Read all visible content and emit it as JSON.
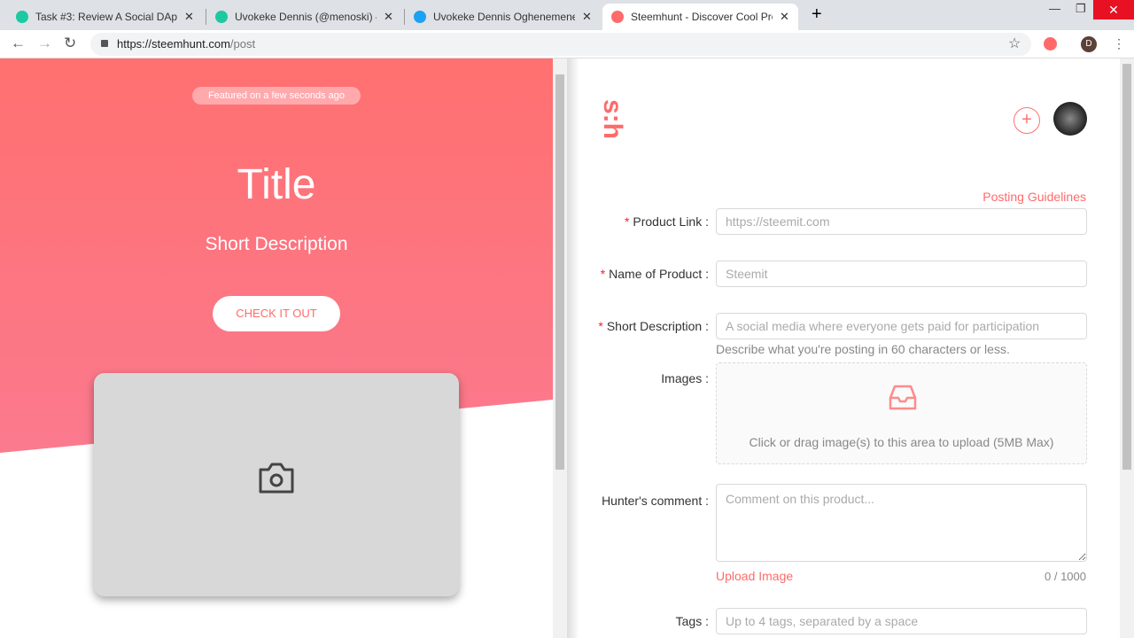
{
  "browser": {
    "tabs": [
      {
        "title": "Task #3: Review A Social DApp! -",
        "icon_color": "#1dc9a0"
      },
      {
        "title": "Uvokeke Dennis (@menoski) — S",
        "icon_color": "#1dc9a0"
      },
      {
        "title": "Uvokeke Dennis Oghenemene on",
        "icon_color": "#1da1f2"
      },
      {
        "title": "Steemhunt - Discover Cool Prod",
        "icon_color": "#ff6b6b"
      }
    ],
    "url_host": "https://steemhunt.com",
    "url_path": "/post",
    "profile_initial": "D"
  },
  "preview": {
    "badge": "Featured on a few seconds ago",
    "title": "Title",
    "short_description": "Short Description",
    "cta": "CHECK IT OUT"
  },
  "header": {
    "logo": "s:h"
  },
  "form": {
    "guidelines": "Posting Guidelines",
    "product_link": {
      "label": "Product Link",
      "placeholder": "https://steemit.com"
    },
    "name": {
      "label": "Name of Product",
      "placeholder": "Steemit"
    },
    "short_description": {
      "label": "Short Description",
      "placeholder": "A social media where everyone gets paid for participation",
      "help": "Describe what you're posting in 60 characters or less."
    },
    "images": {
      "label": "Images",
      "hint": "Click or drag image(s) to this area to upload (5MB Max)"
    },
    "comment": {
      "label": "Hunter's comment",
      "placeholder": "Comment on this product...",
      "upload": "Upload Image",
      "count": "0 / 1000"
    },
    "tags": {
      "label": "Tags",
      "placeholder": "Up to 4 tags, separated by a space"
    }
  }
}
